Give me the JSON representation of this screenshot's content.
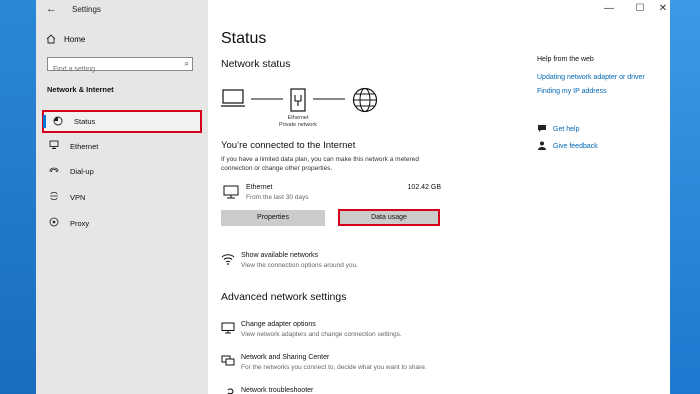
{
  "window": {
    "title": "Settings",
    "back": "←",
    "minimize": "—",
    "maximize": "☐",
    "close": "✕"
  },
  "sidebar": {
    "home": "Home",
    "search_placeholder": "Find a setting",
    "section": "Network & Internet",
    "items": [
      {
        "label": "Status",
        "icon": "status-icon"
      },
      {
        "label": "Ethernet",
        "icon": "ethernet-icon"
      },
      {
        "label": "Dial-up",
        "icon": "dialup-icon"
      },
      {
        "label": "VPN",
        "icon": "vpn-icon"
      },
      {
        "label": "Proxy",
        "icon": "proxy-icon"
      }
    ]
  },
  "main": {
    "title": "Status",
    "network_status": "Network status",
    "diagram_caption_1": "Ethernet",
    "diagram_caption_2": "Private network",
    "connected": "You’re connected to the Internet",
    "desc": "If you have a limited data plan, you can make this network a metered connection or change other properties.",
    "ethernet": {
      "name": "Ethernet",
      "sub": "From the last 30 days",
      "size": "102.42 GB"
    },
    "btn_properties": "Properties",
    "btn_data_usage": "Data usage",
    "show_networks": {
      "title": "Show available networks",
      "desc": "View the connection options around you."
    },
    "advanced": "Advanced network settings",
    "adapter": {
      "title": "Change adapter options",
      "desc": "View network adapters and change connection settings."
    },
    "sharing": {
      "title": "Network and Sharing Center",
      "desc": "For the networks you connect to, decide what you want to share."
    },
    "troubleshooter": {
      "title": "Network troubleshooter"
    }
  },
  "help": {
    "head": "Help from the web",
    "links": [
      "Updating network adapter or driver",
      "Finding my IP address"
    ],
    "get_help": "Get help",
    "feedback": "Give feedback"
  }
}
